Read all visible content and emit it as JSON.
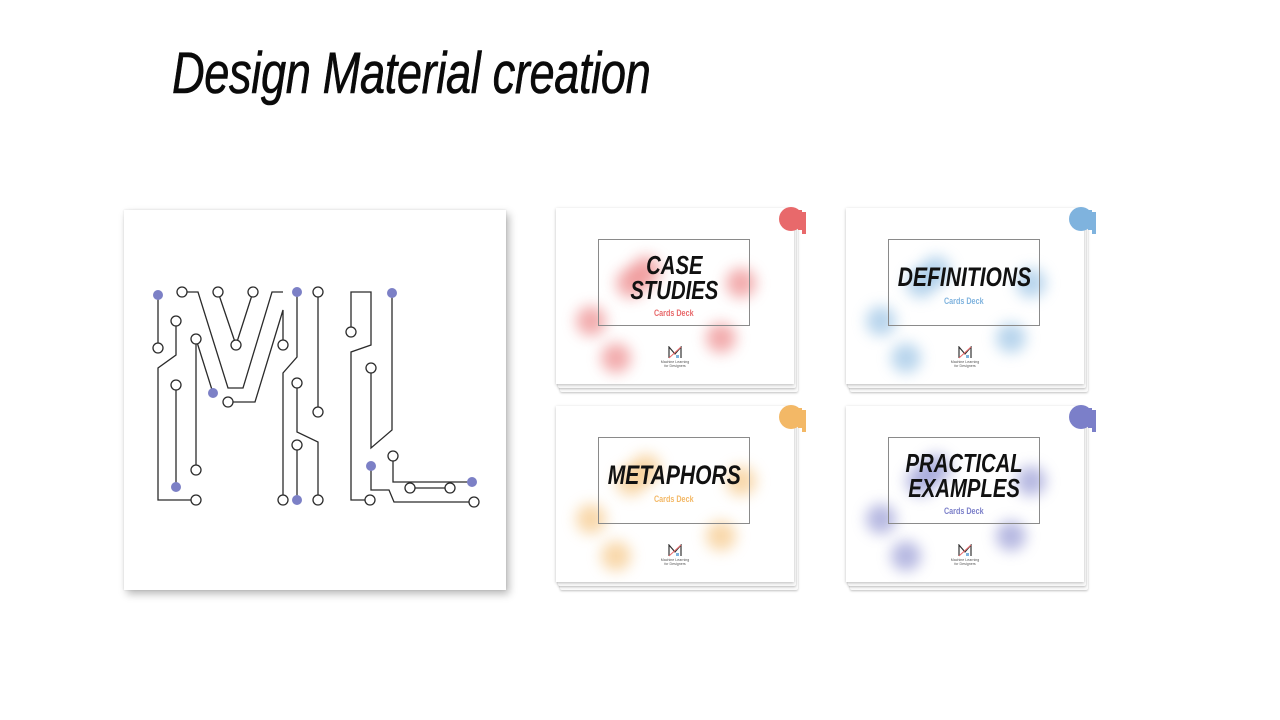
{
  "slide": {
    "title": "Design Material creation"
  },
  "ml_artwork": {
    "label": "ML",
    "node_color": "#7c80c6",
    "line_color": "#2b2b2b"
  },
  "decks": [
    {
      "title_line1": "CASE",
      "title_line2": "STUDIES",
      "subtitle": "Cards Deck",
      "accent": "#e8696b",
      "logo_text_line1": "Machine Learning",
      "logo_text_line2": "for Designers"
    },
    {
      "title_line1": "DEFINITIONS",
      "title_line2": "",
      "subtitle": "Cards Deck",
      "accent": "#7fb3de",
      "logo_text_line1": "Machine Learning",
      "logo_text_line2": "for Designers"
    },
    {
      "title_line1": "METAPHORS",
      "title_line2": "",
      "subtitle": "Cards Deck",
      "accent": "#f3b866",
      "logo_text_line1": "Machine Learning",
      "logo_text_line2": "for Designers"
    },
    {
      "title_line1": "PRACTICAL",
      "title_line2": "EXAMPLES",
      "subtitle": "Cards Deck",
      "accent": "#7b7fc9",
      "logo_text_line1": "Machine Learning",
      "logo_text_line2": "for Designers"
    }
  ]
}
